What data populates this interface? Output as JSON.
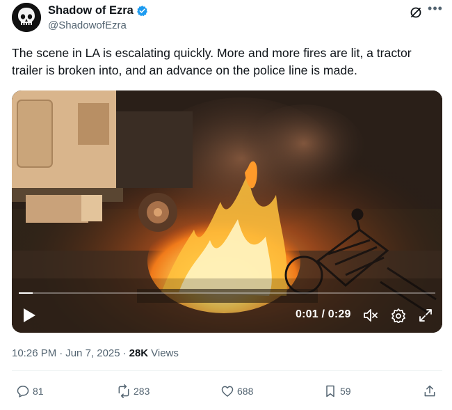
{
  "author": {
    "display_name": "Shadow of Ezra",
    "handle": "@ShadowofEzra",
    "verified": true
  },
  "tweet": {
    "text": "The scene in LA is escalating quickly. More and more fires are lit, a tractor trailer is broken into, and an advance on the police line is made."
  },
  "video": {
    "time_display": "0:01 / 0:29",
    "progress_fraction": 0.034,
    "controls": [
      "play-icon",
      "mute-icon",
      "settings-icon",
      "fullscreen-icon"
    ]
  },
  "meta": {
    "timestamp": "10:26 PM",
    "date": "Jun 7, 2025",
    "separator": "·",
    "views_count": "28K",
    "views_label": "Views"
  },
  "actions": {
    "replies": "81",
    "reposts": "283",
    "likes": "688",
    "bookmarks": "59"
  },
  "colors": {
    "text": "#0f1419",
    "secondary": "#536471",
    "verified_blue": "#1d9bf0",
    "divider": "#eff3f4"
  }
}
